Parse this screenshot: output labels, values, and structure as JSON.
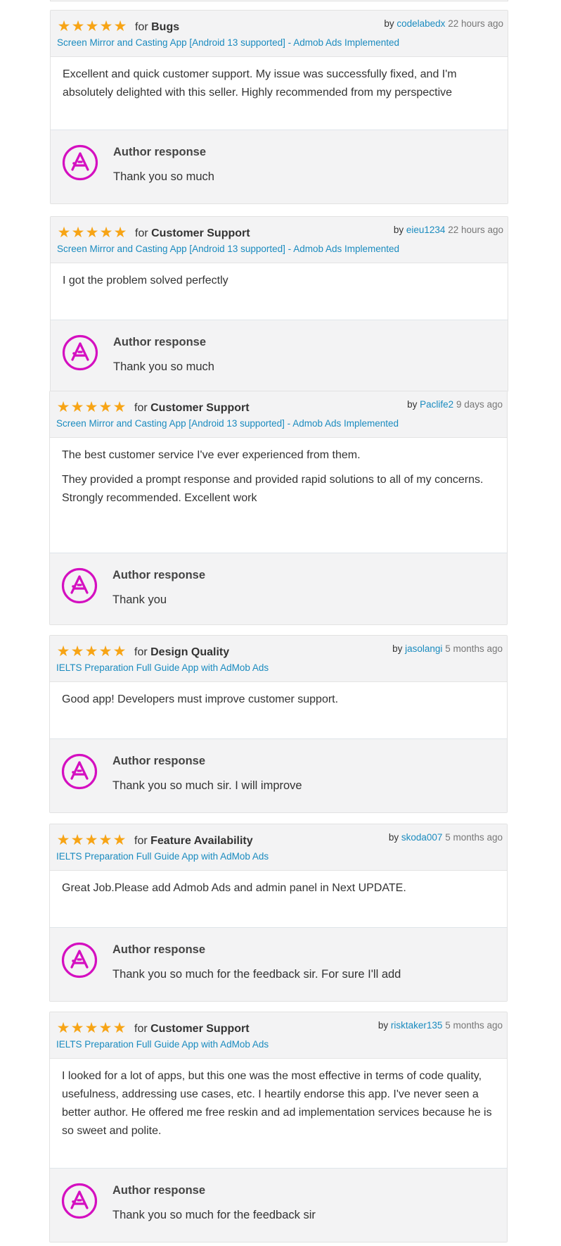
{
  "reviews": [
    {
      "stars": 5,
      "category_prefix": "for",
      "category": "Bugs",
      "by": "by",
      "user": "codelabedx",
      "time": "22 hours ago",
      "product": "Screen Mirror and Casting App [Android 13 supported] - Admob Ads Implemented",
      "body": [
        "Excellent and quick customer support. My issue was successfully fixed, and I'm absolutely delighted with this seller. Highly recommended from my perspective"
      ],
      "response_title": "Author response",
      "response_text": "Thank you so much"
    },
    {
      "stars": 5,
      "category_prefix": "for",
      "category": "Customer Support",
      "by": "by",
      "user": "eieu1234",
      "time": "22 hours ago",
      "product": "Screen Mirror and Casting App [Android 13 supported] - Admob Ads Implemented",
      "body": [
        "I got the problem solved perfectly"
      ],
      "response_title": "Author response",
      "response_text": "Thank you so much"
    },
    {
      "stars": 5,
      "category_prefix": "for",
      "category": "Customer Support",
      "by": "by",
      "user": "Paclife2",
      "time": "9 days ago",
      "product": "Screen Mirror and Casting App [Android 13 supported] - Admob Ads Implemented",
      "body": [
        "The best customer service I've ever experienced from them.",
        "They provided a prompt response and provided rapid solutions to all of my concerns.\nStrongly recommended. Excellent work"
      ],
      "response_title": "Author response",
      "response_text": "Thank you"
    },
    {
      "stars": 5,
      "category_prefix": "for",
      "category": "Design Quality",
      "by": "by",
      "user": "jasolangi",
      "time": "5 months ago",
      "product": "IELTS Preparation Full Guide App with AdMob Ads",
      "body": [
        "Good app! Developers must improve customer support."
      ],
      "response_title": "Author response",
      "response_text": "Thank you so much sir. I will improve"
    },
    {
      "stars": 5,
      "category_prefix": "for",
      "category": "Feature Availability",
      "by": "by",
      "user": "skoda007",
      "time": "5 months ago",
      "product": "IELTS Preparation Full Guide App with AdMob Ads",
      "body": [
        "Great Job.Please add Admob Ads and admin panel in Next UPDATE."
      ],
      "response_title": "Author response",
      "response_text": "Thank you so much for the feedback sir. For sure I'll add"
    },
    {
      "stars": 5,
      "category_prefix": "for",
      "category": "Customer Support",
      "by": "by",
      "user": "risktaker135",
      "time": "5 months ago",
      "product": "IELTS Preparation Full Guide App with AdMob Ads",
      "body": [
        "I looked for a lot of apps, but this one was the most effective in terms of code quality, usefulness, addressing use cases, etc. I heartily endorse this app. I've never seen a better author. He offered me free reskin and ad implementation services because he is so sweet and polite."
      ],
      "response_title": "Author response",
      "response_text": "Thank you so much for the feedback sir"
    }
  ],
  "colors": {
    "star": "#f7a415",
    "link": "#1a8bbf",
    "avatar": "#d40fc0"
  },
  "icons": {
    "star": "star-icon",
    "avatar": "app-store-icon"
  }
}
